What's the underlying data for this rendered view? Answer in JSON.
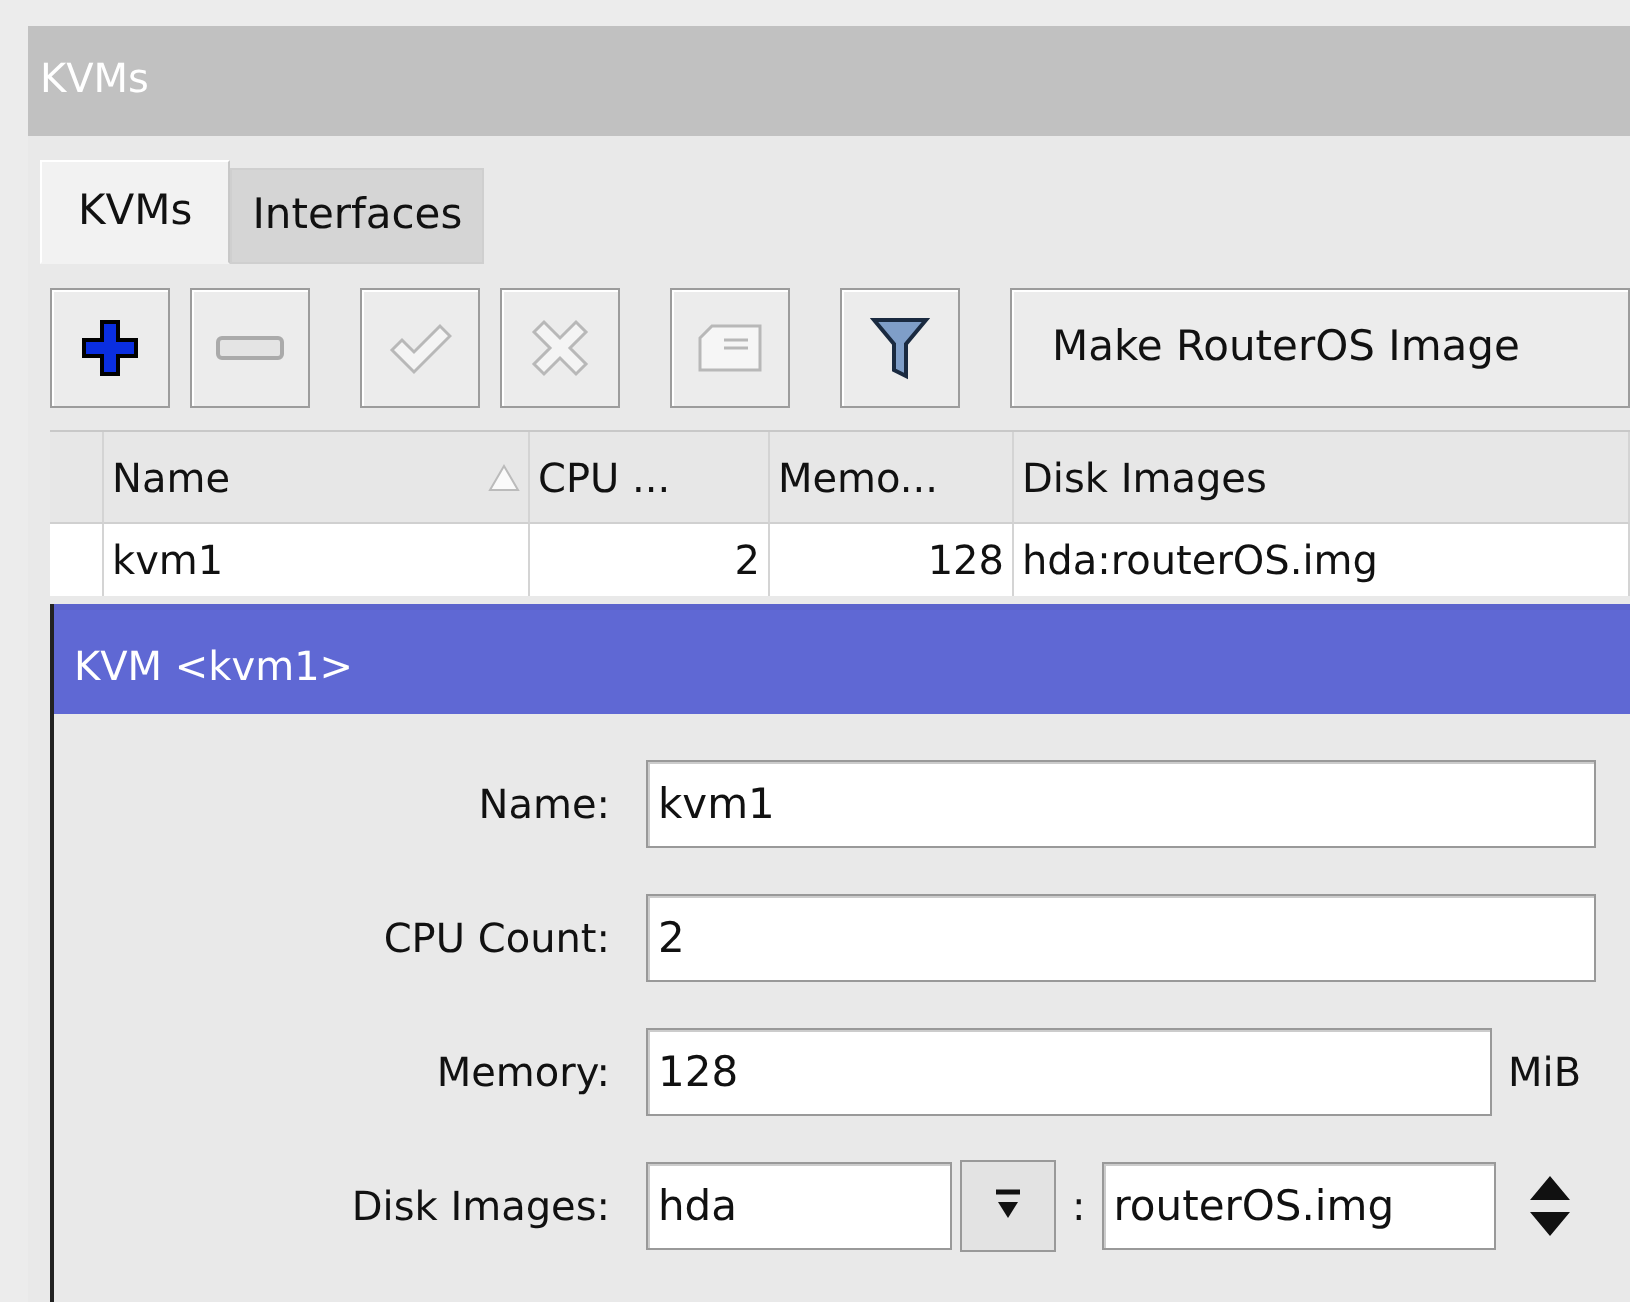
{
  "window": {
    "title": "KVMs"
  },
  "tabs": [
    {
      "label": "KVMs",
      "selected": true
    },
    {
      "label": "Interfaces",
      "selected": false
    }
  ],
  "toolbar": {
    "buttons": [
      {
        "kind": "add",
        "disabled": false
      },
      {
        "kind": "remove",
        "disabled": true
      },
      {
        "kind": "enable",
        "disabled": true
      },
      {
        "kind": "disable",
        "disabled": true
      },
      {
        "kind": "comment",
        "disabled": true
      },
      {
        "kind": "filter",
        "disabled": false
      }
    ],
    "action": "Make RouterOS Image"
  },
  "table": {
    "columns": [
      {
        "label": "Name",
        "sorted": true,
        "numeric": false
      },
      {
        "label": "CPU ...",
        "sorted": false,
        "numeric": true
      },
      {
        "label": "Memo...",
        "sorted": false,
        "numeric": true
      },
      {
        "label": "Disk Images",
        "sorted": false,
        "numeric": false
      }
    ],
    "rows": [
      {
        "cells": [
          "kvm1",
          "2",
          "128",
          "hda:routerOS.img"
        ]
      }
    ]
  },
  "dialog": {
    "title": "KVM <kvm1>",
    "fields": [
      {
        "kind": "text",
        "label": "Name:",
        "value": "kvm1"
      },
      {
        "kind": "text",
        "label": "CPU Count:",
        "value": "2"
      },
      {
        "kind": "unit",
        "label": "Memory:",
        "value": "128",
        "unit": "MiB"
      },
      {
        "kind": "disk",
        "label": "Disk Images:",
        "device": "hda",
        "separator": ":",
        "image": "routerOS.img"
      }
    ]
  }
}
